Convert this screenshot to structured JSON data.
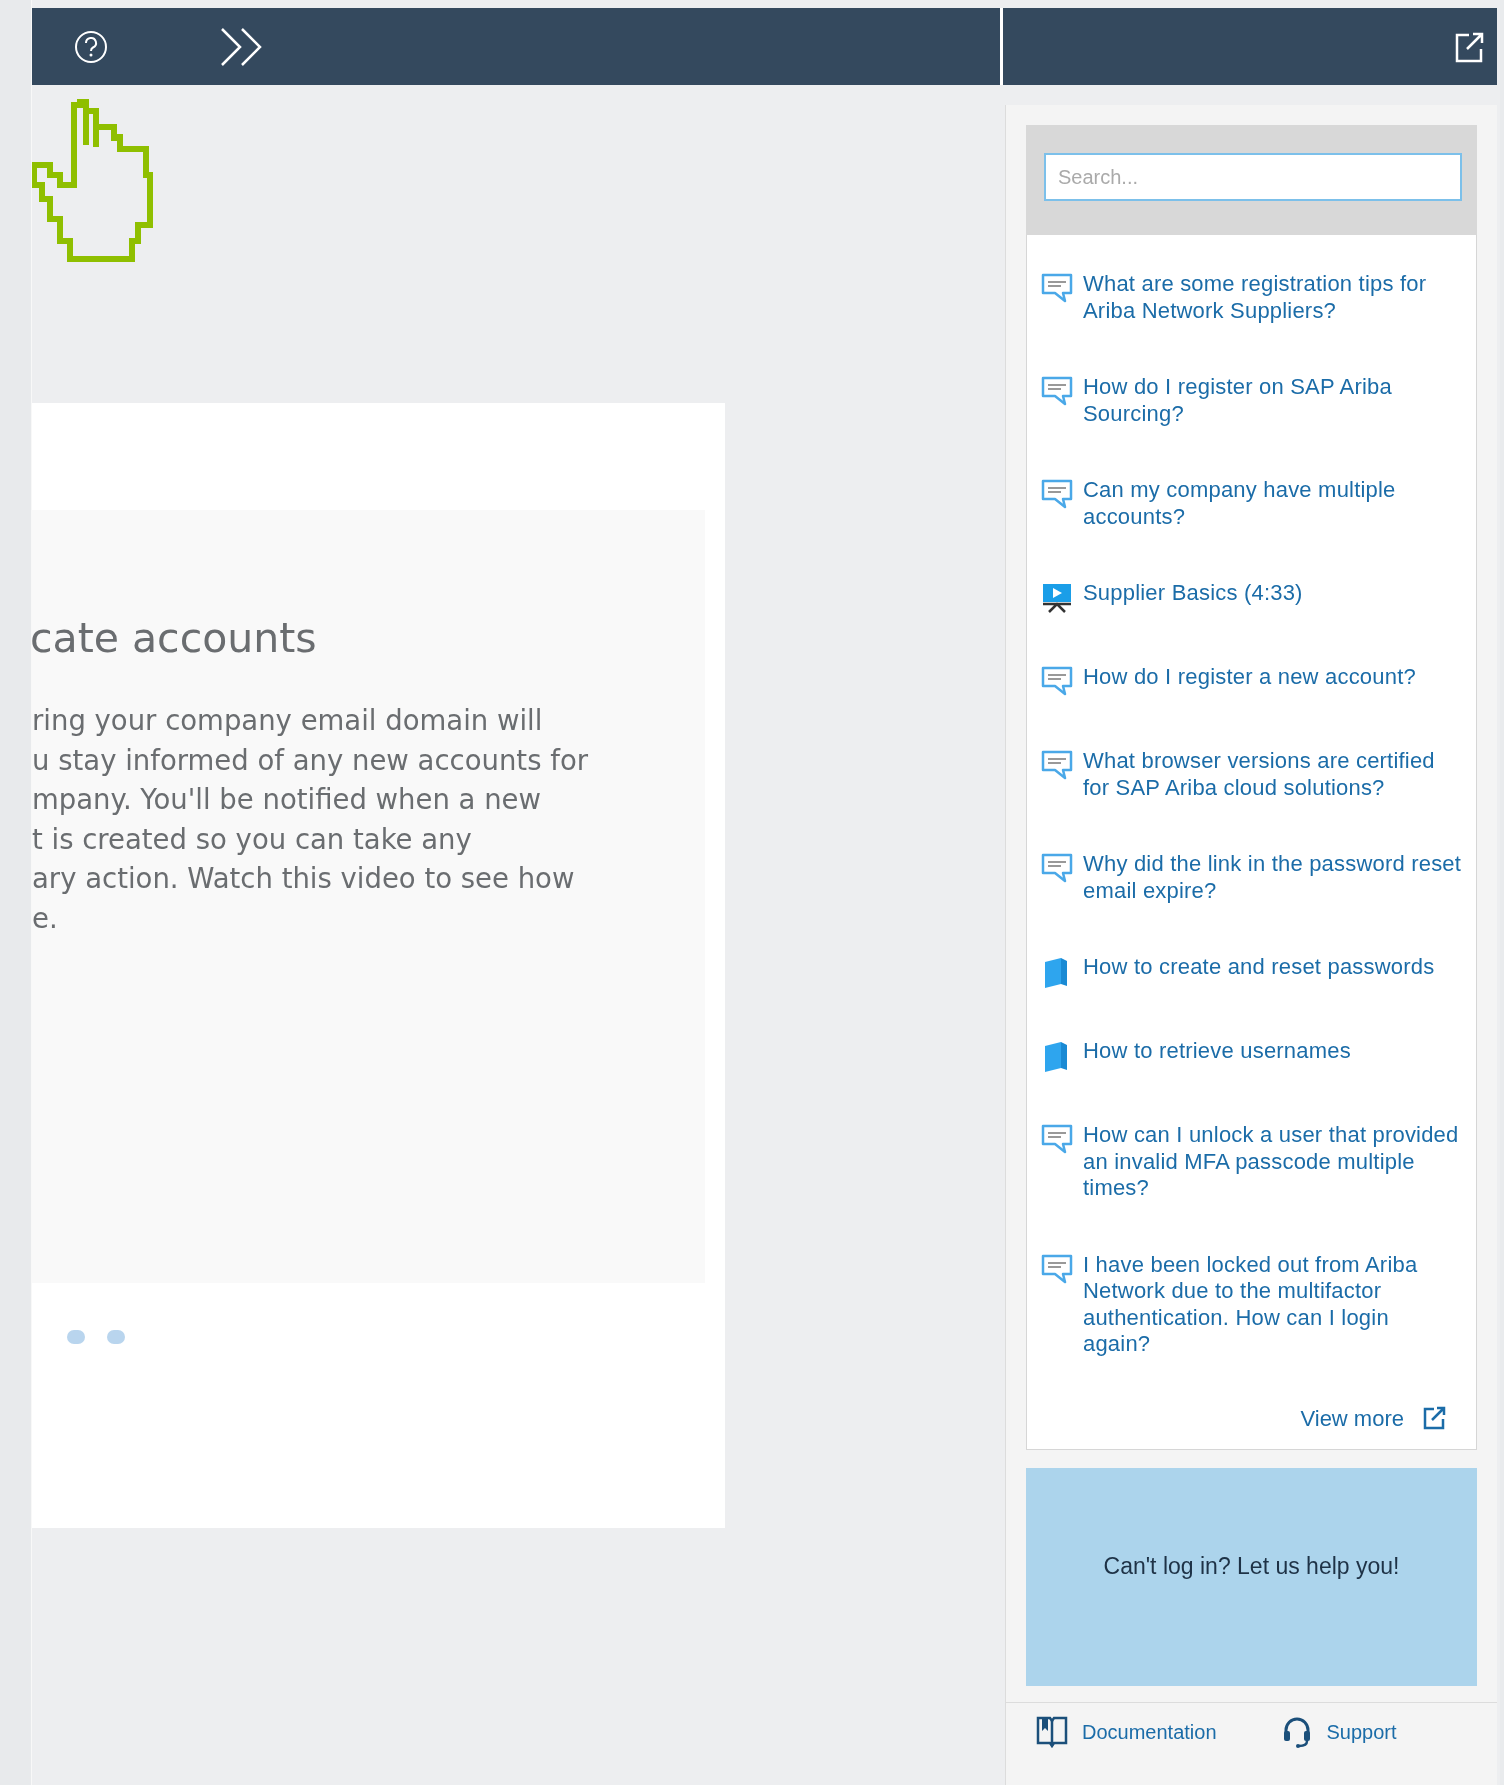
{
  "main": {
    "heading": "cate accounts",
    "paragraph_lines": [
      "ring your company email domain will",
      "u stay informed of any new accounts for",
      "mpany. You'll be notified when a new",
      "t is created so you can take any",
      "ary action. Watch this video to see how",
      "e."
    ],
    "dots": [
      {
        "selected": false
      },
      {
        "selected": false
      }
    ]
  },
  "help_panel": {
    "search": {
      "placeholder": "Search..."
    },
    "items": [
      {
        "kind": "faq",
        "label": "What are some registration tips for Ariba Network Suppliers?"
      },
      {
        "kind": "faq",
        "label": "How do I register on SAP Ariba Sourcing?"
      },
      {
        "kind": "faq",
        "label": "Can my company have multiple accounts?"
      },
      {
        "kind": "video",
        "label": "Supplier Basics (4:33)"
      },
      {
        "kind": "faq",
        "label": "How do I register a new account?"
      },
      {
        "kind": "faq",
        "label": "What browser versions are certified for SAP Ariba cloud solutions?"
      },
      {
        "kind": "faq",
        "label": "Why did the link in the password reset email expire?"
      },
      {
        "kind": "doc",
        "label": "How to create and reset passwords"
      },
      {
        "kind": "doc",
        "label": "How to retrieve usernames"
      },
      {
        "kind": "faq",
        "label": "How can I unlock a user that provided an invalid MFA passcode multiple times?"
      },
      {
        "kind": "faq",
        "label": "I have been locked out from Ariba Network due to the multifactor authentication. How can I login again?"
      }
    ],
    "view_more": "View more",
    "banner": "Can't log in? Let us help you!",
    "footer": [
      {
        "kind": "documentation",
        "label": "Documentation"
      },
      {
        "kind": "support",
        "label": "Support"
      }
    ]
  }
}
